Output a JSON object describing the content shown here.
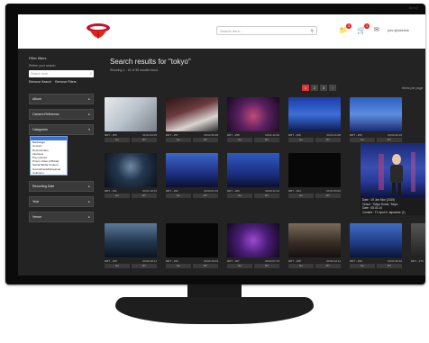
{
  "monitor": {
    "brand": "BenQ"
  },
  "header": {
    "search_placeholder": "Search here...",
    "notifications_count": "3",
    "cart_count": "1",
    "user_email": "john@sitelink"
  },
  "sidebar": {
    "title": "Filter filters",
    "refine_label": "Refine your search:",
    "search_placeholder": "Search here",
    "remove_search": "Remove Search",
    "remove_filters": "Remove Filters",
    "facets": [
      {
        "label": "Album"
      },
      {
        "label": "Camera Reference"
      },
      {
        "label": "Categories"
      },
      {
        "label": "Recording Date"
      },
      {
        "label": "Year"
      },
      {
        "label": "Venue"
      }
    ],
    "dropdown_options": [
      "",
      "Backstage",
      "Concert",
      "Documentary",
      "Interview",
      "Pre-Concert",
      "Promo Video (Official)",
      "Social Media Content",
      "Soundcheck/Rehearsal",
      "Unknown"
    ]
  },
  "main": {
    "title": "Search results for \"tokyo\"",
    "results_count": "Showing 1 - 15 of 35 results found",
    "pagination": [
      "1",
      "2",
      "3",
      "›"
    ],
    "items_per_page": "Items per page",
    "tiles": [
      {
        "id": "RRT - 256",
        "time": "00:01:04:05",
        "a1": "Go",
        "a2": "RT"
      },
      {
        "id": "RRT - 257",
        "time": "00:02:05:28",
        "a1": "Go",
        "a2": "RT"
      },
      {
        "id": "RRT - 258",
        "time": "00:01:12:20",
        "a1": "Go",
        "a2": "RT"
      },
      {
        "id": "RRT - 259",
        "time": "00:03:11:08",
        "a1": "Go",
        "a2": "RT"
      },
      {
        "id": "RRT - 260",
        "time": "00:02:06:16",
        "a1": "Go",
        "a2": "RT"
      },
      {
        "id": "RRT - 261",
        "time": "00:01:18:15",
        "a1": "Go",
        "a2": "RT"
      },
      {
        "id": "RRT - 262",
        "time": "00:02:04:19",
        "a1": "Go",
        "a2": "RT"
      },
      {
        "id": "RRT - 263",
        "time": "00:00:11:12",
        "a1": "Go",
        "a2": "RT"
      },
      {
        "id": "RRT - 264",
        "time": "00:01:05:02",
        "a1": "Go",
        "a2": "RT"
      },
      {
        "id": "RRT - 265",
        "time": "00:00:02:11",
        "a1": "Go",
        "a2": "RT"
      },
      {
        "id": "RRT - 266",
        "time": "00:00:19:04",
        "a1": "Go",
        "a2": "RT"
      },
      {
        "id": "RRT - 267",
        "time": "00:02:07:15",
        "a1": "Go",
        "a2": "RT"
      },
      {
        "id": "RRT - 268",
        "time": "00:00:12:11",
        "a1": "Go",
        "a2": "RT"
      },
      {
        "id": "RRT - 269",
        "time": "00:01:06:10",
        "a1": "Go",
        "a2": "RT"
      },
      {
        "id": "RRT - 270",
        "time": "00:00:14:08",
        "a1": "Go",
        "a2": "RT"
      }
    ],
    "preview": {
      "line1": "Date : 19 Jan Mon (2015)",
      "line2": "Venue : Tokyo Dome, Tokyo",
      "line3": "Date : 08.03.14",
      "line4": "Content : TV spot in Japanese (1)"
    }
  },
  "colors": {
    "accent": "#d33333",
    "background": "#232323",
    "header": "#ffffff"
  }
}
